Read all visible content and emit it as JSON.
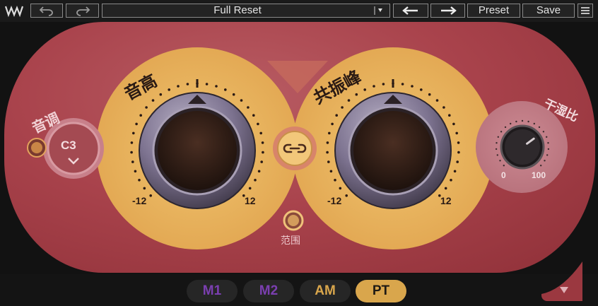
{
  "toolbar": {
    "undo_icon": "undo-icon",
    "redo_icon": "redo-icon",
    "preset_name": "Full Reset",
    "prev_icon": "arrow-left-icon",
    "next_icon": "arrow-right-icon",
    "preset_label": "Preset",
    "save_label": "Save",
    "menu_icon": "hamburger-menu-icon"
  },
  "key": {
    "label": "音调",
    "value": "C3"
  },
  "pitch": {
    "label": "音高",
    "min": "-12",
    "max": "12"
  },
  "formant": {
    "label": "共振峰",
    "min": "-12",
    "max": "12"
  },
  "link": {
    "icon": "link-icon"
  },
  "range": {
    "label": "范围"
  },
  "mix": {
    "label": "干湿比",
    "min": "0",
    "max": "100",
    "value": 70
  },
  "modes": [
    "M1",
    "M2",
    "AM",
    "PT"
  ],
  "colors": {
    "accent": "#e8b060",
    "panel": "#a9434c",
    "mode_purple": "#7b3fb0",
    "mode_active": "#d9a64c"
  }
}
